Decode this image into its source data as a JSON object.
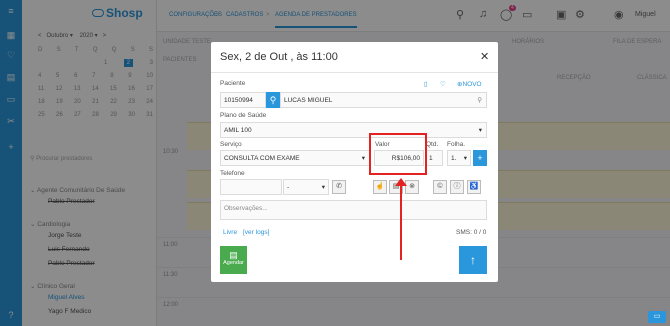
{
  "app": {
    "logo": "Shosp",
    "user": "Miguel",
    "notif_count": "4"
  },
  "breadcrumb": [
    "CONFIGURAÇÕES",
    ">",
    "CADASTROS",
    ">",
    "AGENDA DE PRESTADORES"
  ],
  "calendar": {
    "month": "Outubro",
    "year": "2020",
    "weekdays": [
      "D",
      "S",
      "T",
      "Q",
      "Q",
      "S",
      "S"
    ],
    "rows": [
      [
        "",
        "",
        "",
        "",
        "1",
        "2",
        "3"
      ],
      [
        "4",
        "5",
        "6",
        "7",
        "8",
        "9",
        "10"
      ],
      [
        "11",
        "12",
        "13",
        "14",
        "15",
        "16",
        "17"
      ],
      [
        "18",
        "19",
        "20",
        "21",
        "22",
        "23",
        "24"
      ],
      [
        "25",
        "26",
        "27",
        "28",
        "29",
        "30",
        "31"
      ]
    ],
    "selected": "2"
  },
  "sidebar": {
    "search_placeholder": "Procurar prestadores",
    "groups": [
      {
        "name": "Agente Comunitário De Saúde",
        "items": [
          "Pablo Prestador"
        ]
      },
      {
        "name": "Cardiologia",
        "items": [
          "Jorge Teste",
          "Luis Fernando",
          "Pablo Prestador"
        ]
      },
      {
        "name": "Clínico Geral",
        "items": [
          "Miguel Alves",
          "Yago F Medico"
        ]
      }
    ]
  },
  "main": {
    "times": [
      "10:30",
      "11:00",
      "11:30",
      "12:00"
    ],
    "header": {
      "unidade": "UNIDADE TESTE",
      "pacientes": "PACIENTES",
      "horarios": "HORÁRIOS",
      "fila": "FILA DE ESPERA",
      "recepcao": "RECEPÇÃO",
      "classica": "CLÁSSICA"
    }
  },
  "modal": {
    "title": "Sex, 2 de Out , às 11:00",
    "paciente_label": "Paciente",
    "novo_label": "NOVO",
    "paciente_id": "10150994",
    "paciente_name": "LUCAS MIGUEL",
    "plano_label": "Plano de Saúde",
    "plano_value": "AMIL 100",
    "servico_label": "Serviço",
    "servico_value": "CONSULTA COM EXAME",
    "valor_label": "Valor",
    "valor_value": "R$106,00",
    "qtd_label": "Qtd.",
    "qtd_value": "1",
    "folha_label": "Folha.",
    "folha_value": "1.",
    "telefone_label": "Telefone",
    "telefone_select": "-",
    "observacoes_placeholder": "Observações...",
    "livre": "Livre",
    "ver_logs": "[ver logs]",
    "sms": "SMS: 0 / 0",
    "agendar": "Agendar"
  }
}
